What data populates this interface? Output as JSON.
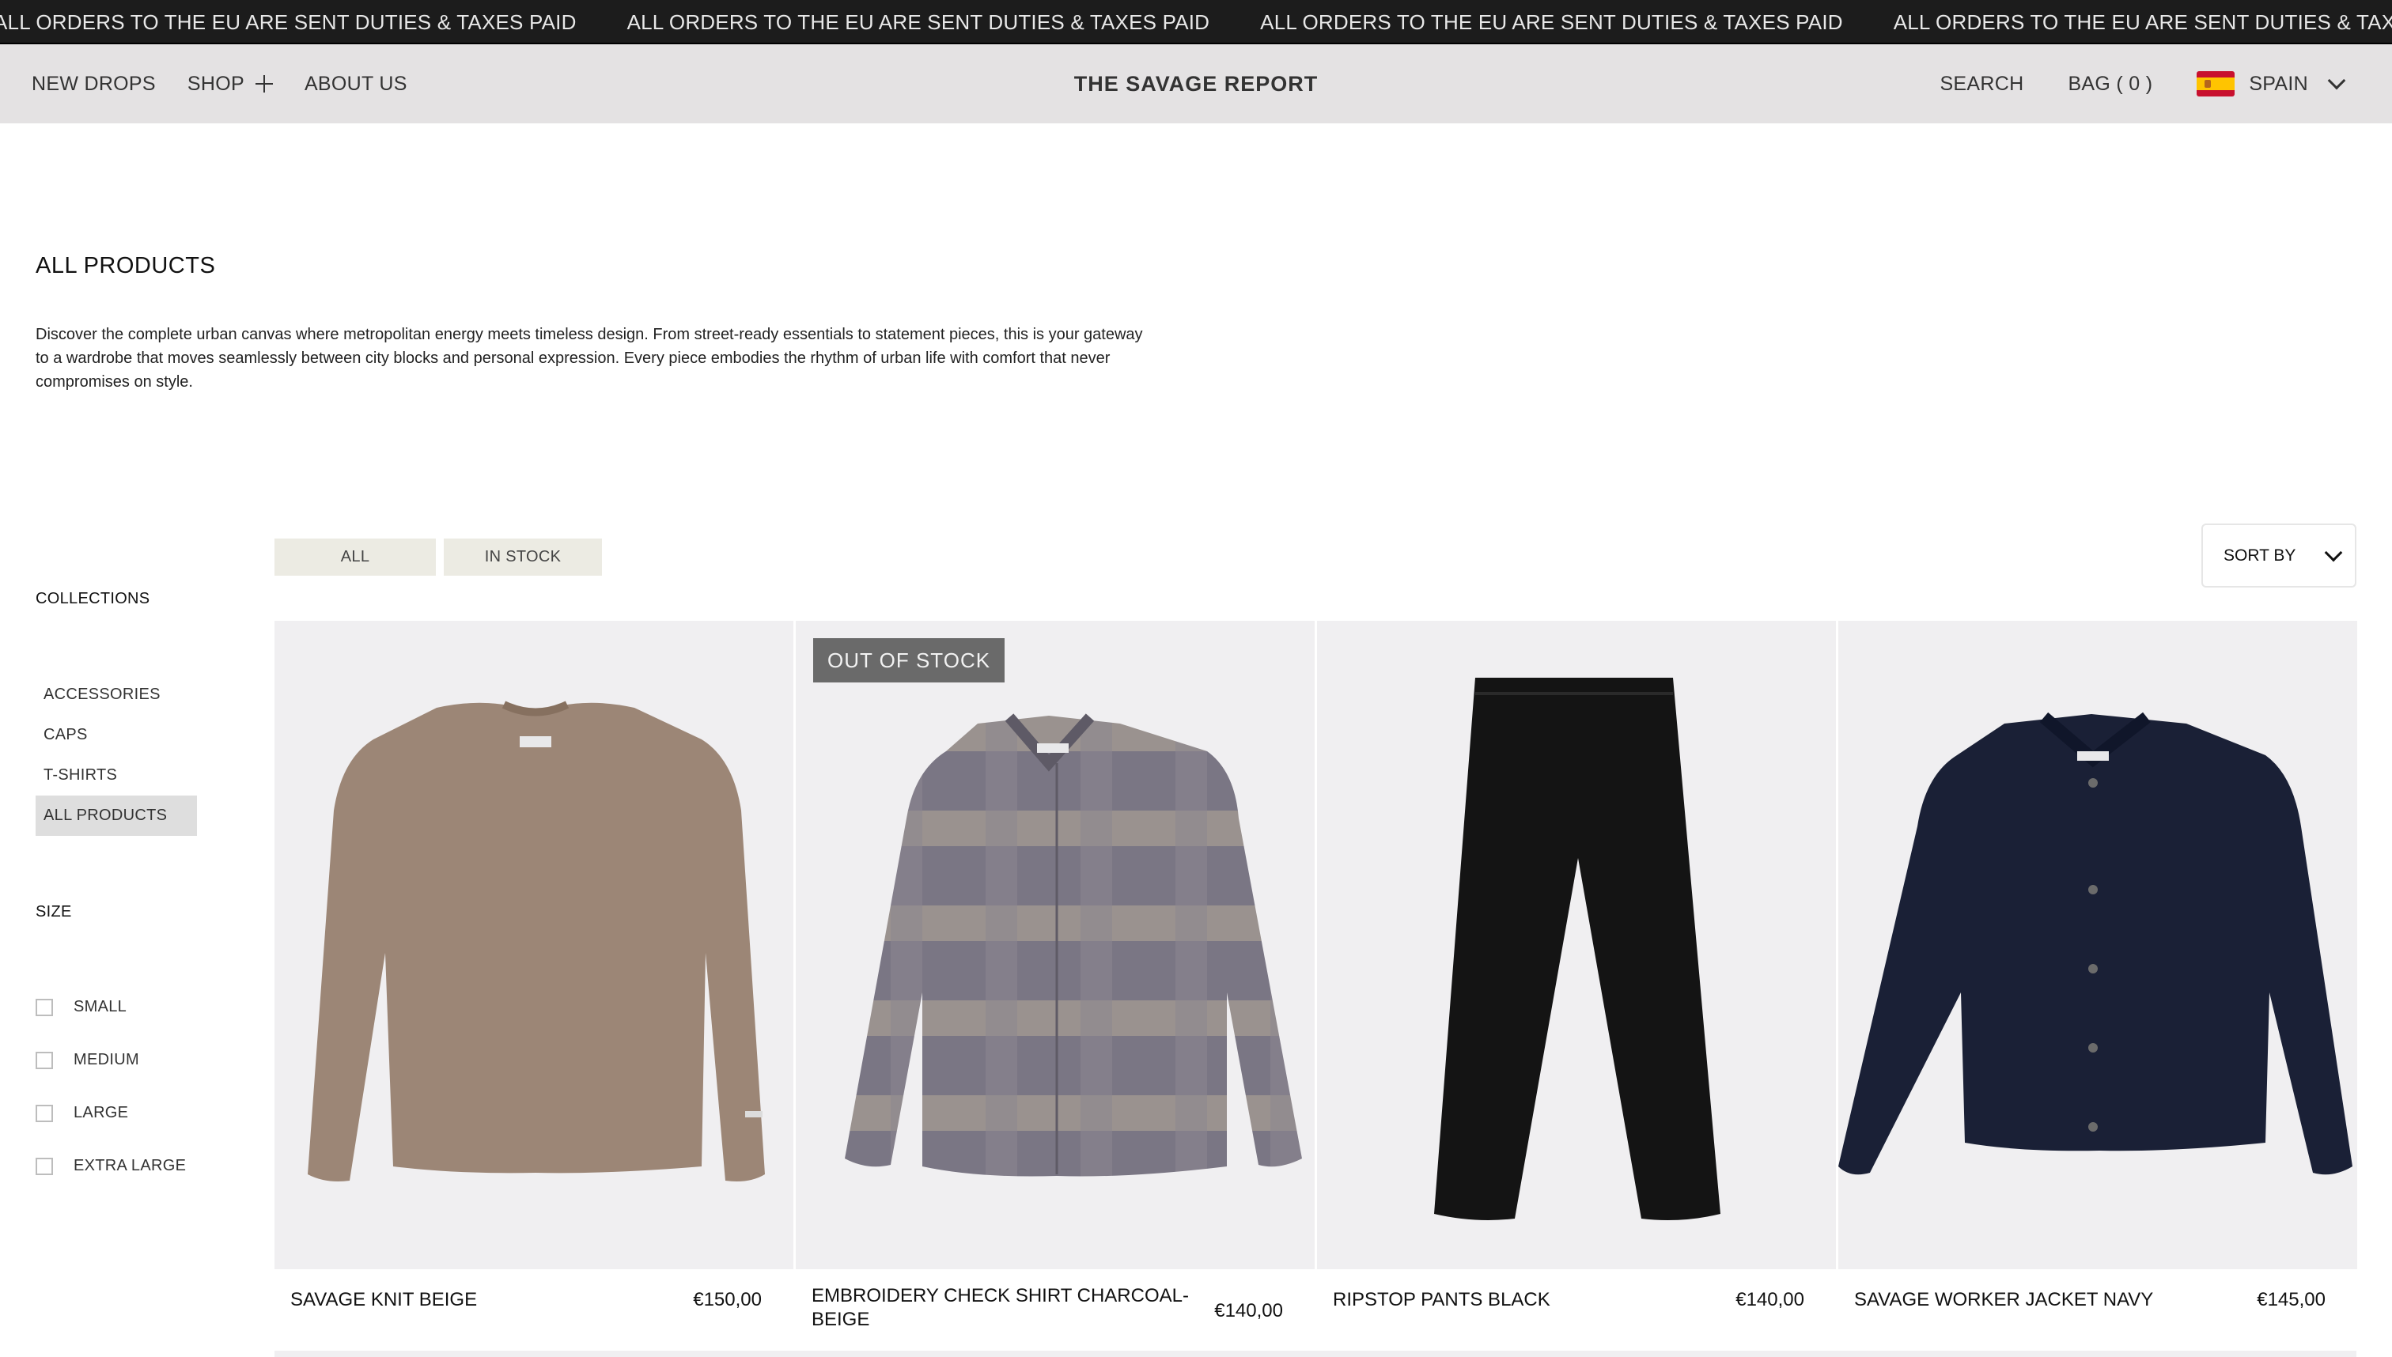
{
  "announcement": {
    "text": "ALL ORDERS TO THE EU ARE SENT DUTIES & TAXES PAID",
    "repeat": 5
  },
  "header": {
    "nav": [
      {
        "label": "NEW DROPS"
      },
      {
        "label": "SHOP"
      },
      {
        "label": "ABOUT US"
      }
    ],
    "brand": "THE SAVAGE REPORT",
    "search_label": "SEARCH",
    "bag_label": "BAG ( 0 )",
    "country": "SPAIN",
    "country_flag_icon": "spain-flag-icon"
  },
  "intro": {
    "title": "ALL PRODUCTS",
    "description": "Discover the complete urban canvas where metropolitan energy meets timeless design. From street-ready essentials to statement pieces, this is your gateway to a wardrobe that moves seamlessly between city blocks and personal expression. Every piece embodies the rhythm of urban life with comfort that never compromises on style."
  },
  "filters": {
    "chips": [
      {
        "label": "ALL"
      },
      {
        "label": "IN STOCK"
      }
    ],
    "sort_label": "SORT BY"
  },
  "sidebar": {
    "collections_heading": "COLLECTIONS",
    "collections": [
      {
        "label": "ACCESSORIES",
        "active": false
      },
      {
        "label": "CAPS",
        "active": false
      },
      {
        "label": "T-SHIRTS",
        "active": false
      },
      {
        "label": "ALL PRODUCTS",
        "active": true
      }
    ],
    "size_heading": "SIZE",
    "sizes": [
      {
        "label": "SMALL",
        "checked": false
      },
      {
        "label": "MEDIUM",
        "checked": false
      },
      {
        "label": "LARGE",
        "checked": false
      },
      {
        "label": "EXTRA LARGE",
        "checked": false
      }
    ]
  },
  "products": [
    {
      "name": "SAVAGE KNIT BEIGE",
      "price": "€150,00",
      "badge": "",
      "image_icon": "beige-knit-sweater-image",
      "color": "#9c8676"
    },
    {
      "name": "EMBROIDERY CHECK SHIRT CHARCOAL-BEIGE",
      "price": "€140,00",
      "badge": "OUT  OF STOCK",
      "image_icon": "check-shirt-image",
      "color": "#7a7684"
    },
    {
      "name": "RIPSTOP PANTS BLACK",
      "price": "€140,00",
      "badge": "",
      "image_icon": "black-pants-image",
      "color": "#141414"
    },
    {
      "name": "SAVAGE WORKER JACKET NAVY",
      "price": "€145,00",
      "badge": "",
      "image_icon": "navy-jacket-image",
      "color": "#1a2036"
    }
  ]
}
